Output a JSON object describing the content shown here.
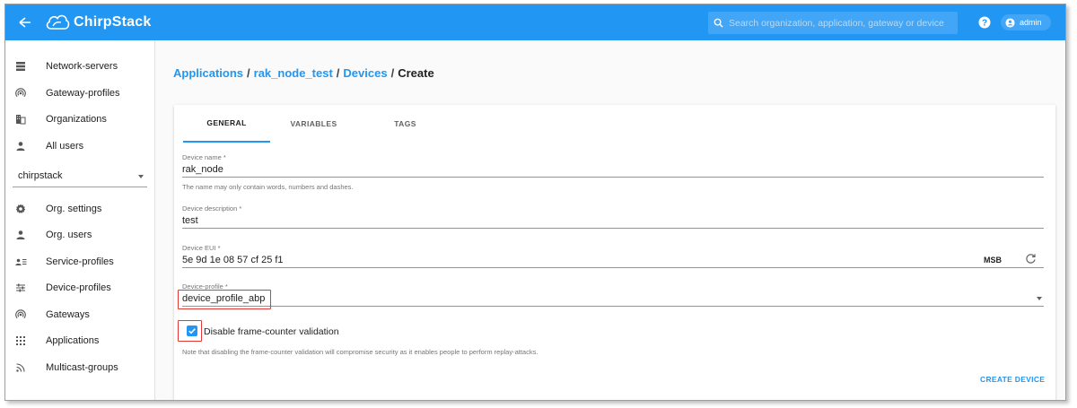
{
  "app": {
    "name": "ChirpStack"
  },
  "header": {
    "search_placeholder": "Search organization, application, gateway or device",
    "user": "admin"
  },
  "sidebar": {
    "top_items": [
      {
        "label": "Network-servers",
        "icon": "server-stack-icon"
      },
      {
        "label": "Gateway-profiles",
        "icon": "wifi-tethering-icon"
      },
      {
        "label": "Organizations",
        "icon": "domain-icon"
      },
      {
        "label": "All users",
        "icon": "person-icon"
      }
    ],
    "org_select": "chirpstack",
    "org_items": [
      {
        "label": "Org. settings",
        "icon": "gear-icon"
      },
      {
        "label": "Org. users",
        "icon": "person-icon"
      },
      {
        "label": "Service-profiles",
        "icon": "account-details-icon"
      },
      {
        "label": "Device-profiles",
        "icon": "tune-icon"
      },
      {
        "label": "Gateways",
        "icon": "wifi-tethering-icon"
      },
      {
        "label": "Applications",
        "icon": "apps-grid-icon"
      },
      {
        "label": "Multicast-groups",
        "icon": "rss-icon"
      }
    ]
  },
  "breadcrumb": {
    "items": [
      "Applications",
      "rak_node_test",
      "Devices"
    ],
    "separator": "/",
    "current": "Create"
  },
  "tabs": [
    "GENERAL",
    "VARIABLES",
    "TAGS"
  ],
  "form": {
    "device_name": {
      "label": "Device name *",
      "value": "rak_node",
      "helper": "The name may only contain words, numbers and dashes."
    },
    "device_description": {
      "label": "Device description *",
      "value": "test"
    },
    "device_eui": {
      "label": "Device EUI *",
      "value": "5e 9d 1e 08 57 cf 25 f1",
      "byte_order": "MSB"
    },
    "device_profile": {
      "label": "Device-profile *",
      "value": "device_profile_abp"
    },
    "disable_fcnt": {
      "label": "Disable frame-counter validation",
      "checked": true,
      "helper": "Note that disabling the frame-counter validation will compromise security as it enables people to perform replay-attacks."
    },
    "submit_label": "CREATE DEVICE"
  },
  "colors": {
    "primary": "#2196f3",
    "highlight": "#e53935"
  }
}
